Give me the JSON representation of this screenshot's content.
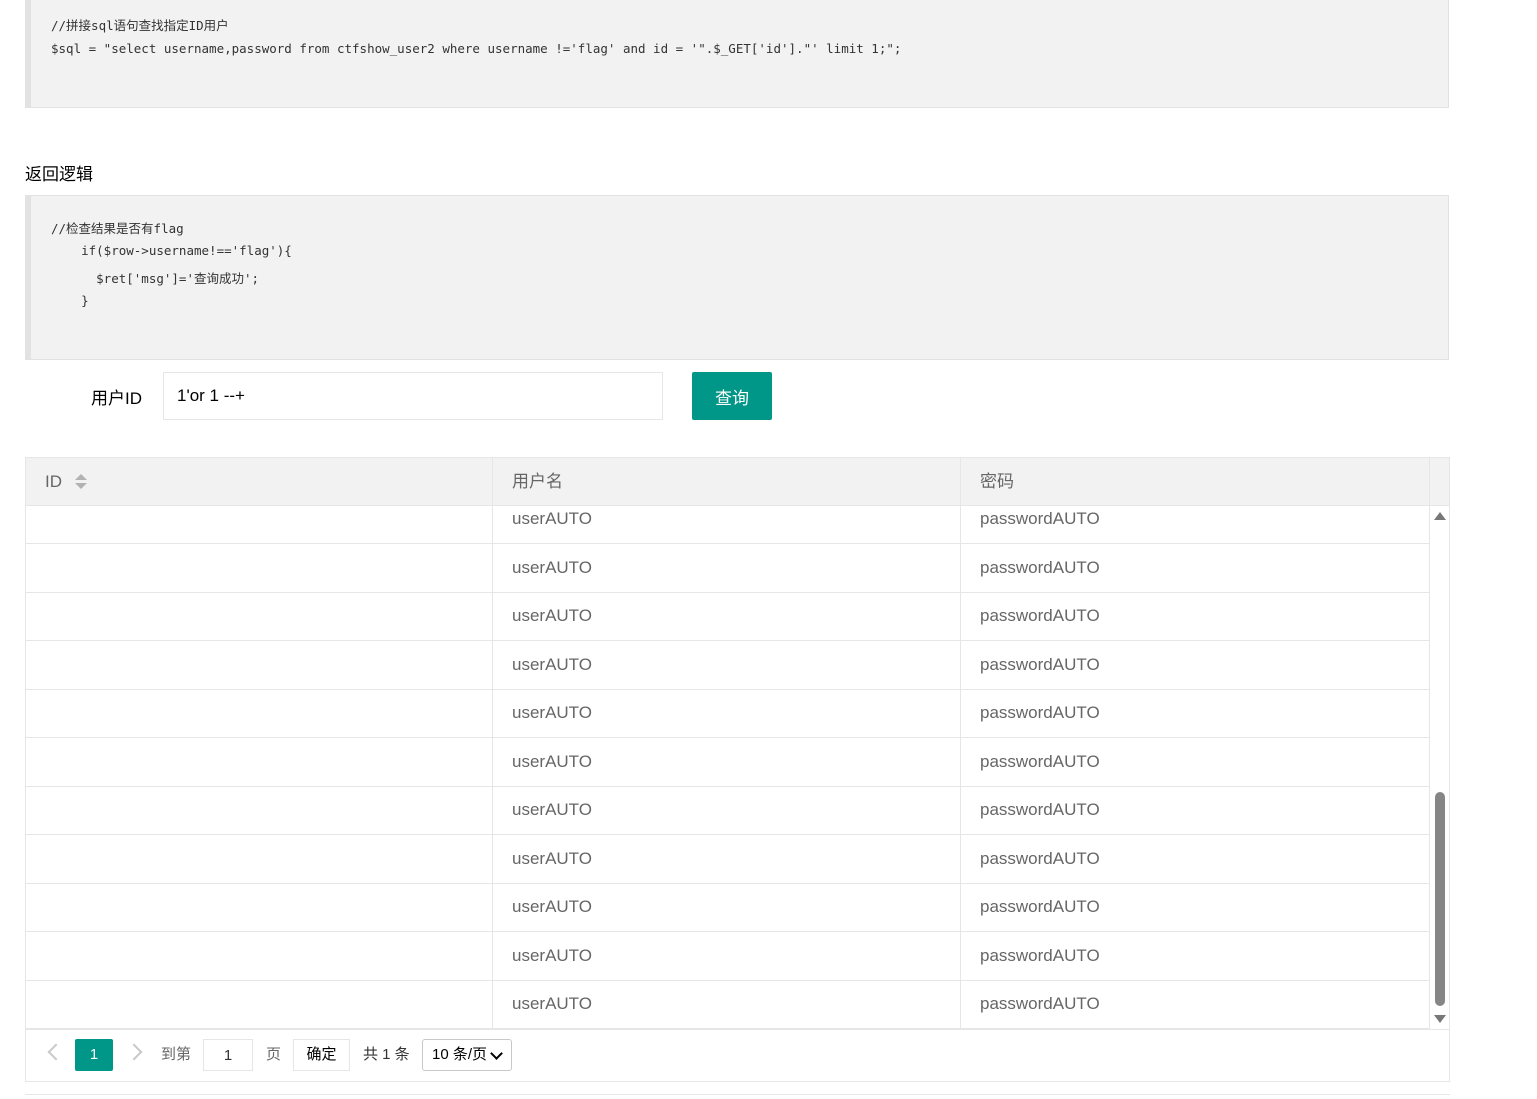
{
  "code_sql": {
    "comment": "//拼接sql语句查找指定ID用户",
    "statement": "$sql = \"select username,password from ctfshow_user2 where username !='flag' and id = '\".$_GET['id'].\"' limit 1;\";"
  },
  "return_logic": {
    "title": "返回逻辑",
    "lines": [
      "//检查结果是否有flag",
      "    if($row->username!=='flag'){",
      "      $ret['msg']='查询成功';",
      "    }"
    ]
  },
  "query_form": {
    "label": "用户ID",
    "value": "1'or 1 --+",
    "button": "查询"
  },
  "table": {
    "headers": [
      "ID",
      "用户名",
      "密码"
    ],
    "rows": [
      {
        "id": "",
        "username": "userAUTO",
        "password": "passwordAUTO"
      },
      {
        "id": "",
        "username": "userAUTO",
        "password": "passwordAUTO"
      },
      {
        "id": "",
        "username": "userAUTO",
        "password": "passwordAUTO"
      },
      {
        "id": "",
        "username": "userAUTO",
        "password": "passwordAUTO"
      },
      {
        "id": "",
        "username": "userAUTO",
        "password": "passwordAUTO"
      },
      {
        "id": "",
        "username": "userAUTO",
        "password": "passwordAUTO"
      },
      {
        "id": "",
        "username": "userAUTO",
        "password": "passwordAUTO"
      },
      {
        "id": "",
        "username": "userAUTO",
        "password": "passwordAUTO"
      },
      {
        "id": "",
        "username": "userAUTO",
        "password": "passwordAUTO"
      },
      {
        "id": "",
        "username": "userAUTO",
        "password": "passwordAUTO"
      },
      {
        "id": "",
        "username": "userAUTO",
        "password": "passwordAUTO"
      }
    ]
  },
  "pagination": {
    "current_page": "1",
    "goto_label": "到第",
    "goto_value": "1",
    "page_label": "页",
    "confirm": "确定",
    "total": "共 1 条",
    "page_size": "10 条/页"
  },
  "colors": {
    "accent": "#009688"
  }
}
